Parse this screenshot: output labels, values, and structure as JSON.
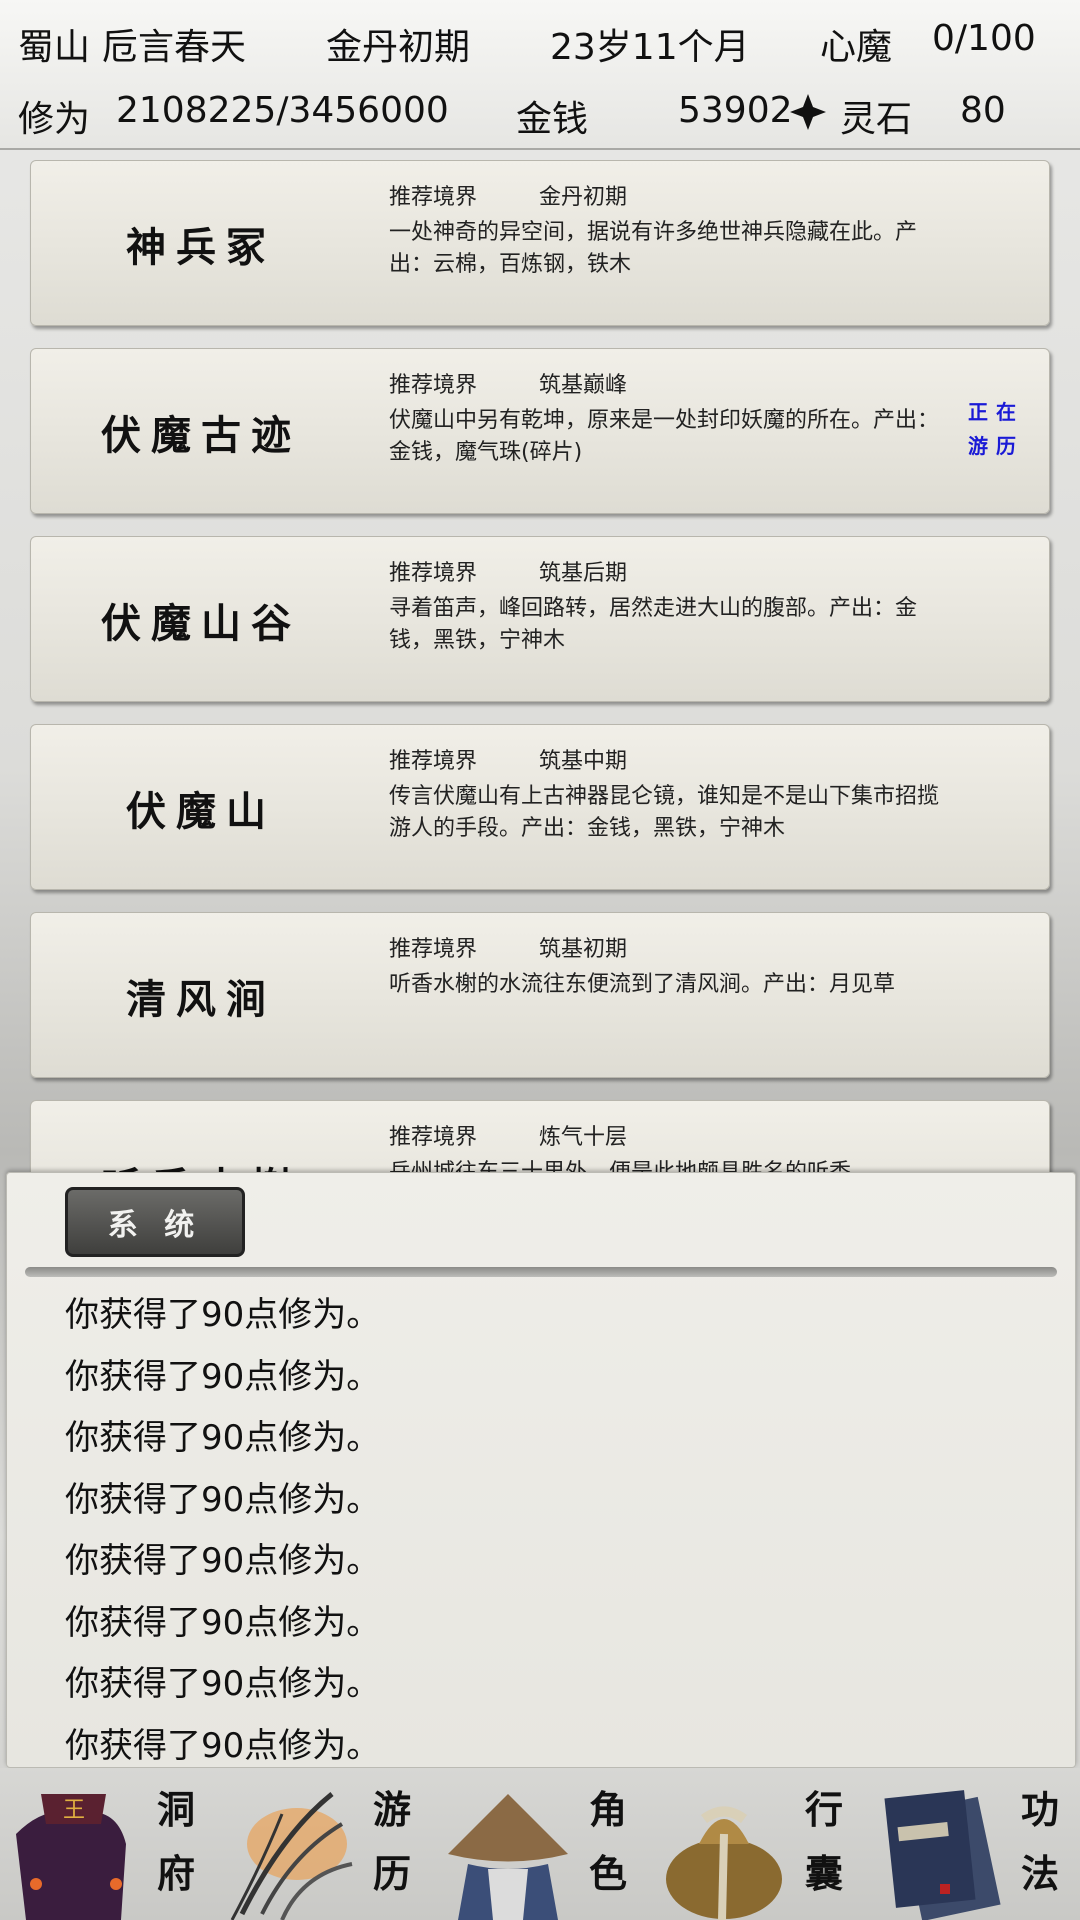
{
  "status": {
    "sect": "蜀山",
    "name": "卮言春天",
    "realm": "金丹初期",
    "age": "23岁11个月",
    "demon_label": "心魔",
    "demon_value": "0/100",
    "cultivation_label": "修为",
    "cultivation_value": "2108225/3456000",
    "money_label": "金钱",
    "money_value": "53902",
    "stone_label": "灵石",
    "stone_value": "80"
  },
  "locations": [
    {
      "name": "神兵冢",
      "realm_label": "推荐境界",
      "realm": "金丹初期",
      "desc": "一处神奇的异空间，据说有许多绝世神兵隐藏在此。产出：云棉，百炼钢，铁木",
      "status": ""
    },
    {
      "name": "伏魔古迹",
      "realm_label": "推荐境界",
      "realm": "筑基巅峰",
      "desc": "伏魔山中另有乾坤，原来是一处封印妖魔的所在。产出：金钱，魔气珠(碎片)",
      "status": "正在游历"
    },
    {
      "name": "伏魔山谷",
      "realm_label": "推荐境界",
      "realm": "筑基后期",
      "desc": "寻着笛声，峰回路转，居然走进大山的腹部。产出：金钱，黑铁，宁神木",
      "status": ""
    },
    {
      "name": "伏魔山",
      "realm_label": "推荐境界",
      "realm": "筑基中期",
      "desc": "传言伏魔山有上古神器昆仑镜，谁知是不是山下集市招揽游人的手段。产出：金钱，黑铁，宁神木",
      "status": ""
    },
    {
      "name": "清风涧",
      "realm_label": "推荐境界",
      "realm": "筑基初期",
      "desc": "听香水榭的水流往东便流到了清风涧。产出：月见草",
      "status": ""
    },
    {
      "name": "听香水榭",
      "realm_label": "推荐境界",
      "realm": "炼气十层",
      "desc": "岳州城往东三十里外，便是此地颇具胜名的听香",
      "status": ""
    }
  ],
  "system": {
    "tab_label": "系 统",
    "messages": [
      "你获得了90点修为。",
      "你获得了90点修为。",
      "你获得了90点修为。",
      "你获得了90点修为。",
      "你获得了90点修为。",
      "你获得了90点修为。",
      "你获得了90点修为。",
      "你获得了90点修为。"
    ]
  },
  "nav": [
    {
      "label_top": "洞",
      "label_bottom": "府",
      "icon": "cave-dwelling-icon"
    },
    {
      "label_top": "游",
      "label_bottom": "历",
      "icon": "travel-icon"
    },
    {
      "label_top": "角",
      "label_bottom": "色",
      "icon": "character-icon"
    },
    {
      "label_top": "行",
      "label_bottom": "囊",
      "icon": "bag-icon"
    },
    {
      "label_top": "功",
      "label_bottom": "法",
      "icon": "skill-book-icon"
    }
  ],
  "colors": {
    "status_text": "#1a1ad6",
    "card_bg": "#e8e6de"
  }
}
